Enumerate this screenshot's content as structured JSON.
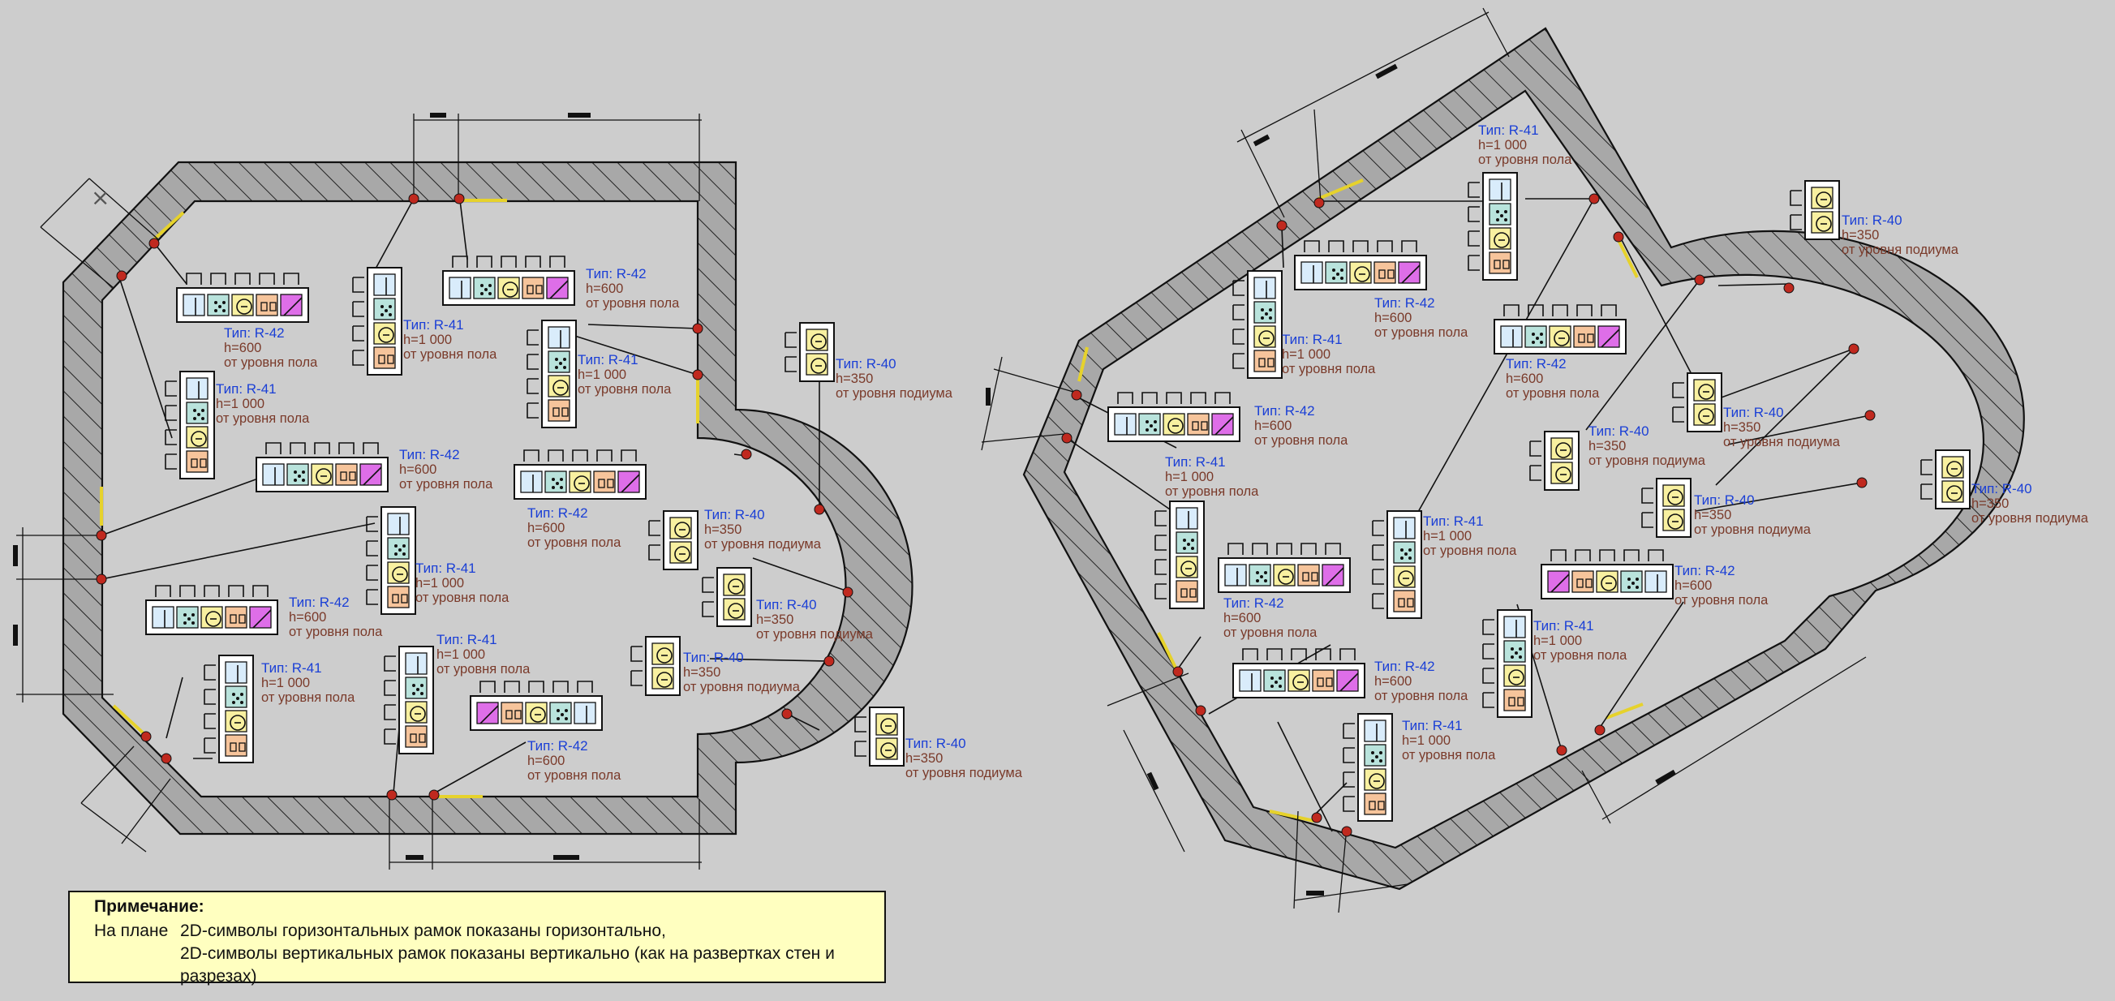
{
  "labels": {
    "r40": "Тип: R-40",
    "r41": "Тип: R-41",
    "r42": "Тип: R-42",
    "h350": "h=350",
    "h600": "h=600",
    "h1000": "h=1 000",
    "floor": "от уровня пола",
    "podium": "от уровня подиума"
  },
  "frame_types": {
    "R-40": [
      "socket",
      "socket"
    ],
    "R-41": [
      "switch",
      "network",
      "socket",
      "power"
    ],
    "R-42": [
      "switch",
      "network",
      "socket",
      "power",
      "ac"
    ],
    "R-42-reversed": [
      "ac",
      "power",
      "socket",
      "network",
      "switch"
    ]
  },
  "colors": {
    "switch": "#d9ecfb",
    "network": "#b9e3dc",
    "socket": "#f8f0a0",
    "power": "#f6c49b",
    "ac": "#de6ee8",
    "wall": "#a8a8a8",
    "node": "#c0291f",
    "type_text": "#1a3fd6",
    "height_text": "#7a3a2a",
    "note_background": "#ffffc0"
  },
  "note": {
    "title": "Примечание:",
    "label": "На плане",
    "line1": "2D-символы горизонтальных рамок показаны горизонтально,",
    "line2": "2D-символы вертикальных рамок показаны вертикально (как на развертках стен и разрезах)"
  }
}
